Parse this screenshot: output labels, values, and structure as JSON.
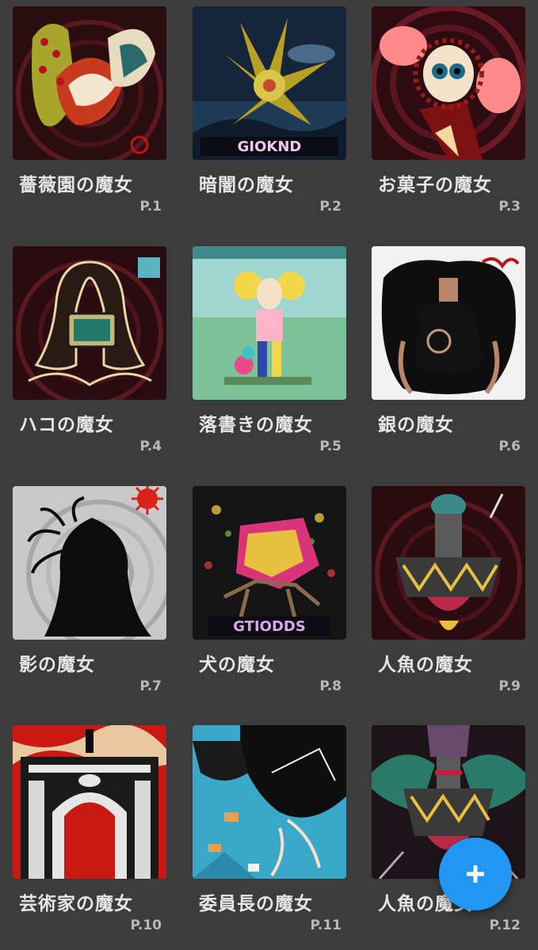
{
  "cards": [
    {
      "title": "薔薇園の魔女",
      "page": "P.1"
    },
    {
      "title": "暗闇の魔女",
      "page": "P.2"
    },
    {
      "title": "お菓子の魔女",
      "page": "P.3"
    },
    {
      "title": "ハコの魔女",
      "page": "P.4"
    },
    {
      "title": "落書きの魔女",
      "page": "P.5"
    },
    {
      "title": "銀の魔女",
      "page": "P.6"
    },
    {
      "title": "影の魔女",
      "page": "P.7"
    },
    {
      "title": "犬の魔女",
      "page": "P.8"
    },
    {
      "title": "人魚の魔女",
      "page": "P.9"
    },
    {
      "title": "芸術家の魔女",
      "page": "P.10"
    },
    {
      "title": "委員長の魔女",
      "page": "P.11"
    },
    {
      "title": "人魚の魔女",
      "page": "P.12"
    }
  ],
  "thumb_captions": {
    "card2": "GIOKND",
    "card8": "GTIODDS"
  },
  "fab": {
    "icon": "plus-icon",
    "color": "#2196f3"
  },
  "colors": {
    "background": "#3c3c3c",
    "title_text": "#e6e6e6",
    "page_text": "#b9b9b9"
  }
}
